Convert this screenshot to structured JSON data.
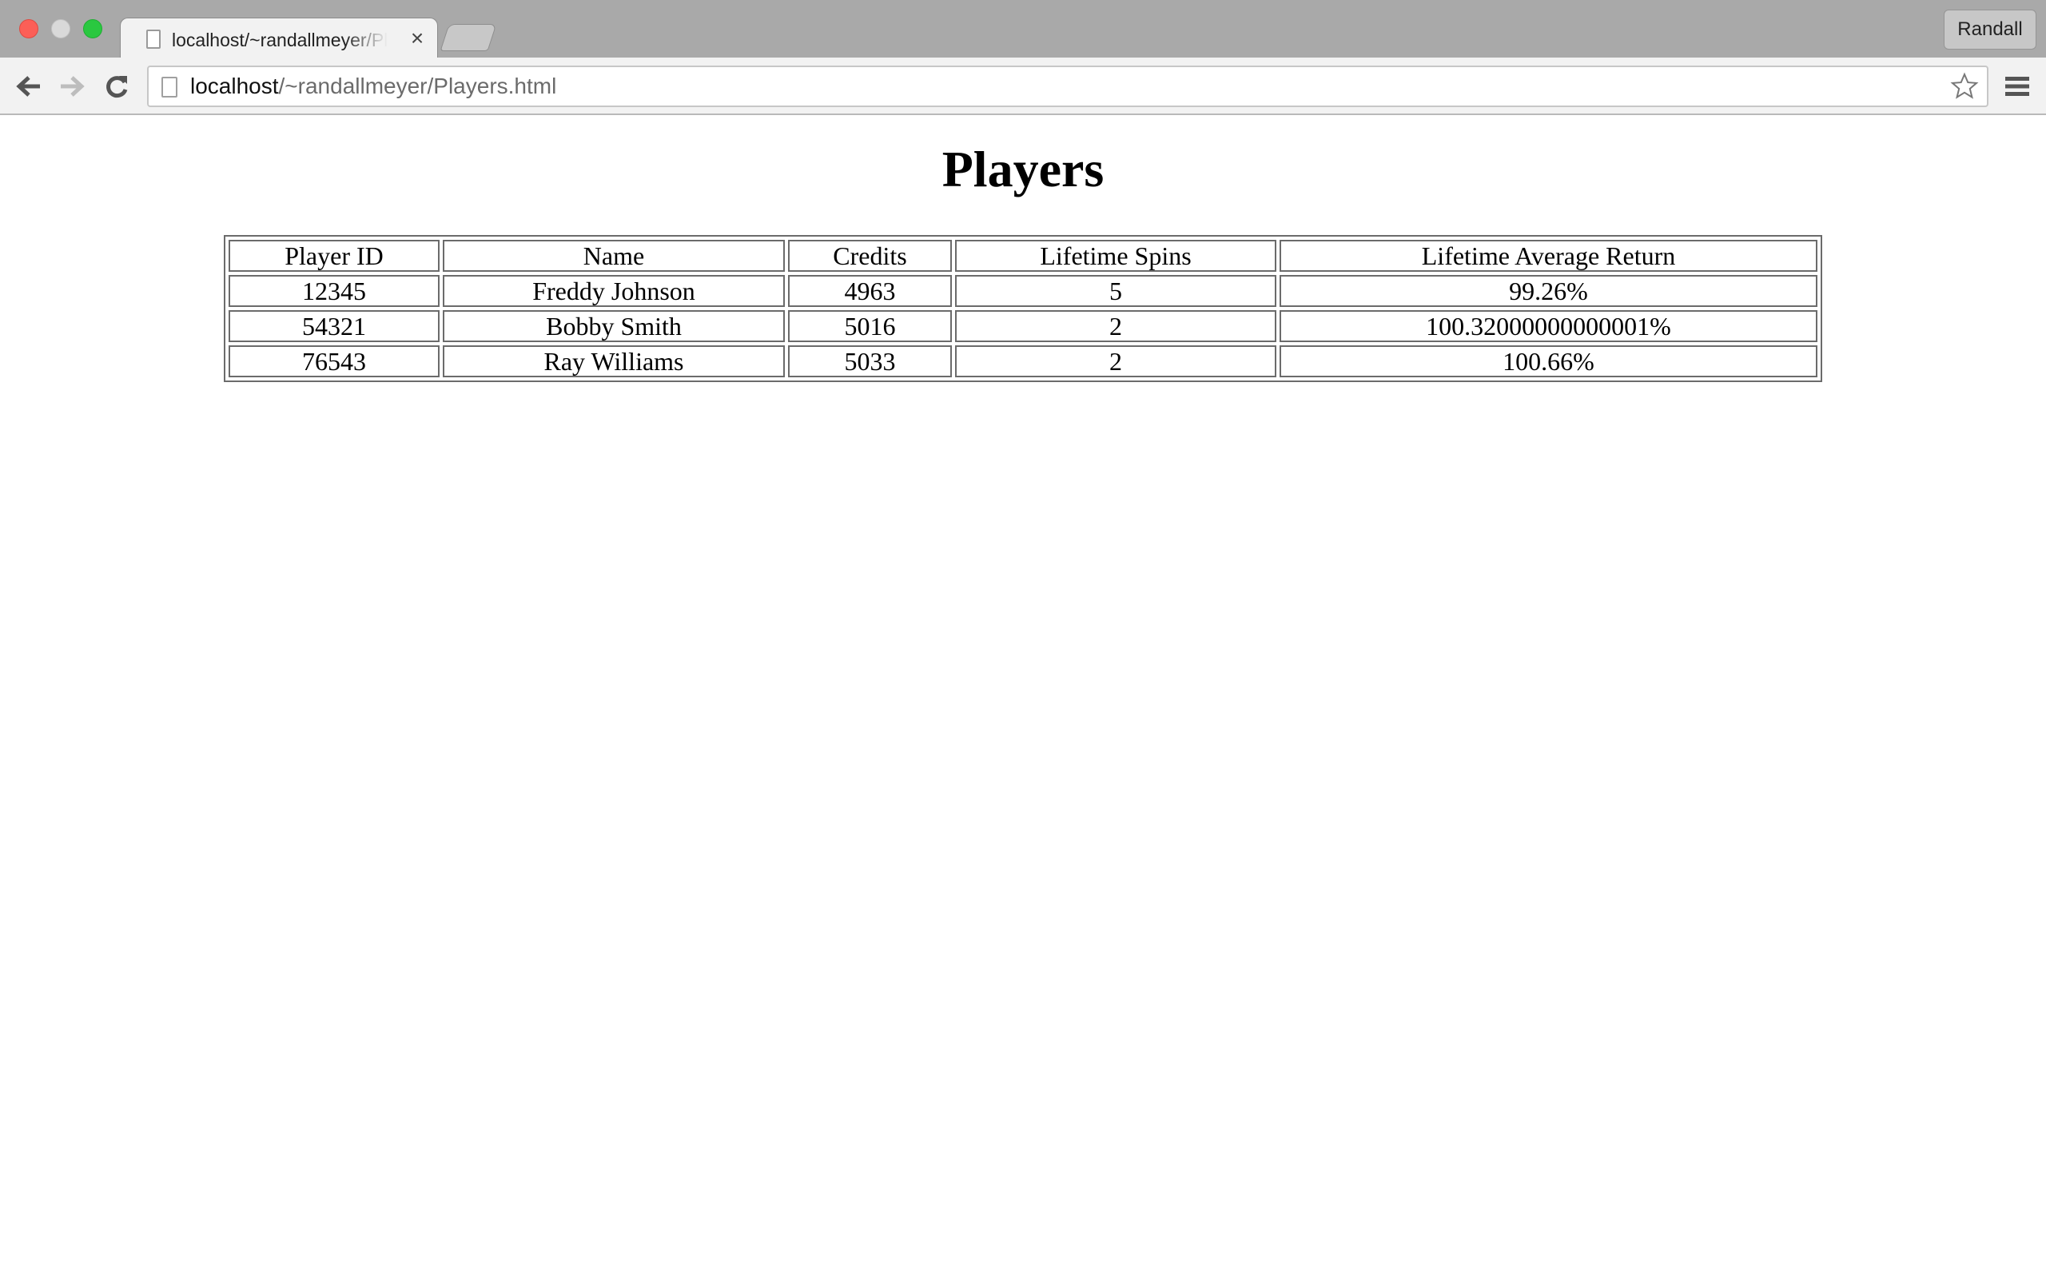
{
  "browser": {
    "tab": {
      "title": "localhost/~randallmeyer/Players.html",
      "close_glyph": "×"
    },
    "profile_name": "Randall",
    "address": {
      "host": "localhost",
      "path": "/~randallmeyer/Players.html"
    },
    "icons": {
      "back": "back-arrow-icon",
      "forward": "forward-arrow-icon",
      "reload": "reload-icon",
      "page": "page-icon",
      "bookmark": "star-icon",
      "menu": "hamburger-menu-icon"
    }
  },
  "page": {
    "title": "Players",
    "table": {
      "headers": [
        "Player ID",
        "Name",
        "Credits",
        "Lifetime Spins",
        "Lifetime Average Return"
      ],
      "rows": [
        [
          "12345",
          "Freddy Johnson",
          "4963",
          "5",
          "99.26%"
        ],
        [
          "54321",
          "Bobby Smith",
          "5016",
          "2",
          "100.32000000000001%"
        ],
        [
          "76543",
          "Ray Williams",
          "5033",
          "2",
          "100.66%"
        ]
      ]
    }
  }
}
